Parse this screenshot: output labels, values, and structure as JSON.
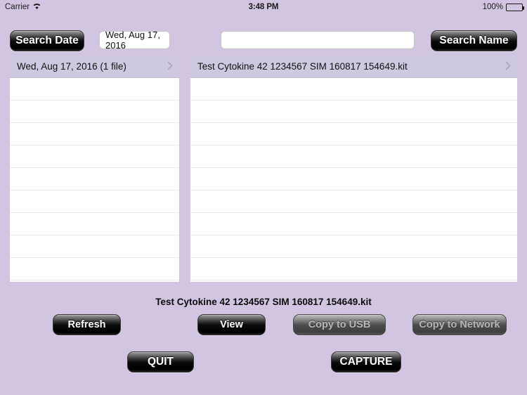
{
  "statusbar": {
    "carrier": "Carrier",
    "wifi_icon": "wifi-icon",
    "time": "3:48 PM",
    "battery_percent": "100%",
    "battery_icon": "battery-full-icon"
  },
  "toolbar": {
    "search_date_label": "Search Date",
    "date_field_value": "Wed, Aug 17, 2016",
    "name_field_value": "",
    "name_field_placeholder": "",
    "search_name_label": "Search Name"
  },
  "date_list": {
    "rows": [
      {
        "label": "Wed, Aug 17, 2016 (1 file)",
        "selected": true,
        "chevron": "chevron-right-icon"
      }
    ],
    "empty_row_count": 9
  },
  "file_list": {
    "rows": [
      {
        "label": "Test Cytokine 42 1234567 SIM 160817 154649.kit",
        "selected": true,
        "chevron": "chevron-right-icon"
      }
    ],
    "empty_row_count": 9
  },
  "selected_file": "Test Cytokine 42 1234567 SIM 160817 154649.kit",
  "actions": {
    "refresh_label": "Refresh",
    "view_label": "View",
    "copy_usb_label": "Copy to USB",
    "copy_network_label": "Copy to Network",
    "quit_label": "QUIT",
    "capture_label": "CAPTURE"
  },
  "colors": {
    "background": "#d1c5e2",
    "row_selected": "#cec8e0",
    "button_dark": "#000000",
    "button_disabled_text": "#b6b6b6"
  }
}
